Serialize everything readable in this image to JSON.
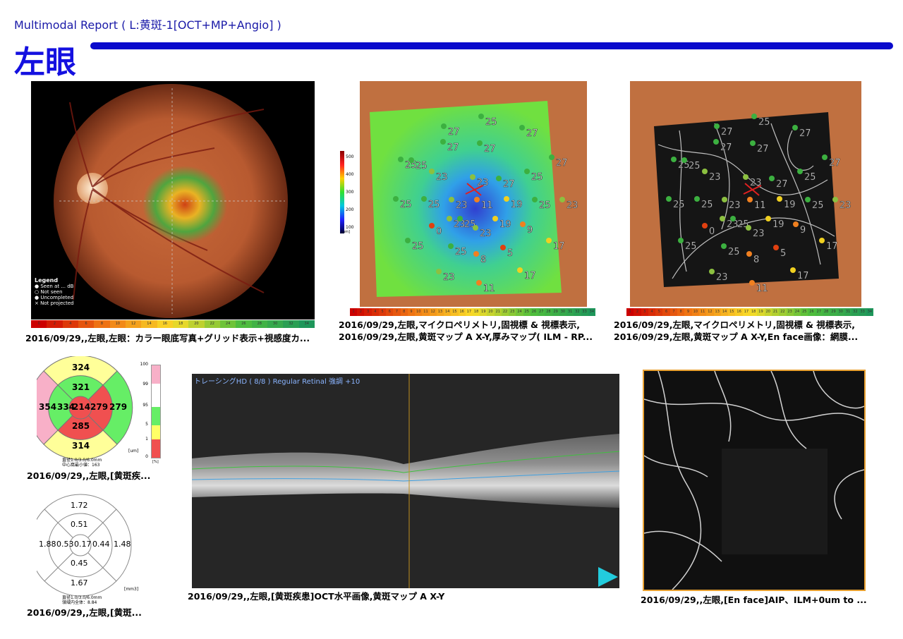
{
  "header": {
    "title": "Multimodal Report ( L:黄斑-1[OCT+MP+Angio] )",
    "eye": "左眼"
  },
  "fundus": {
    "legend_title": "Legend",
    "legend_items": [
      "Seen at ... dB",
      "Not seen",
      "Uncompleted",
      "Not projected"
    ],
    "scale_labels": [
      "0",
      "2",
      "4",
      "6",
      "8",
      "10",
      "12",
      "14",
      "16",
      "18",
      "20",
      "22",
      "24",
      "26",
      "28",
      "30",
      "32",
      "34"
    ],
    "caption": "2016/09/29,,左眼,左眼：カラー眼底写真+グリッド表示+視感度カ..."
  },
  "thickness_map": {
    "colorbar_ticks": [
      "500",
      "400",
      "300",
      "200",
      "100"
    ],
    "colorbar_unit": "[um]",
    "caption_line1": "2016/09/29,左眼,マイクロペリメトリ,固視標 & 視標表示,",
    "caption_line2": "2016/09/29,左眼,黄斑マップ A X-Y,厚みマップ( ILM - RP..."
  },
  "enface_overlay": {
    "caption_line1": "2016/09/29,左眼,マイクロペリメトリ,固視標 & 視標表示,",
    "caption_line2": "2016/09/29,左眼,黄斑マップ A X-Y,En face画像：網膜..."
  },
  "perimetry_scale": [
    "1",
    "2",
    "3",
    "4",
    "5",
    "6",
    "7",
    "8",
    "9",
    "10",
    "11",
    "12",
    "13",
    "14",
    "15",
    "16",
    "17",
    "18",
    "19",
    "20",
    "21",
    "22",
    "23",
    "24",
    "25",
    "26",
    "27",
    "28",
    "29",
    "30",
    "31",
    "32",
    "33",
    "34"
  ],
  "perimetry_points": [
    "25",
    "27",
    "27",
    "27",
    "27",
    "25",
    "25",
    "27",
    "25",
    "23",
    "23",
    "27",
    "25",
    "25",
    "23",
    "25",
    "23",
    "11",
    "19",
    "23",
    "25",
    "19",
    "0",
    "25",
    "25",
    "23",
    "8",
    "5",
    "17",
    "9",
    "17",
    "23",
    "11"
  ],
  "etdrs_thickness": {
    "outer_top": "324",
    "inner_top": "321",
    "outer_left": "354",
    "inner_left": "334",
    "center": "214",
    "inner_right": "279",
    "outer_right": "279",
    "inner_bottom": "285",
    "outer_bottom": "314",
    "unit": "[um]",
    "legend_ticks": [
      "100",
      "99",
      "95",
      "5",
      "1",
      "0"
    ],
    "legend_unit": "[%]",
    "note1": "直径1.0/3.0/6.0mm",
    "note2": "中心窩最小値：163",
    "caption": "2016/09/29,,左眼,[黄斑疾..."
  },
  "etdrs_volume": {
    "outer_top": "1.72",
    "inner_top": "0.51",
    "outer_left": "1.88",
    "inner_left": "0.53",
    "center": "0.17",
    "inner_right": "0.44",
    "outer_right": "1.48",
    "inner_bottom": "0.45",
    "outer_bottom": "1.67",
    "unit": "[mm3]",
    "note1": "直径1.0/3.0/6.0mm",
    "note2": "領域内全体：8.84",
    "caption": "2016/09/29,,左眼,[黄斑..."
  },
  "oct": {
    "overlay_label": "トレーシングHD ( 8/8 ) Regular Retinal  強調 +10",
    "caption": "2016/09/29,,左眼,[黄斑疾患]OCT水平画像,黄斑マップ A X-Y"
  },
  "angio": {
    "caption": "2016/09/29,,左眼,[En face]AIP、ILM+0um to ..."
  },
  "colors": {
    "accent_blue": "#0a0acc",
    "angio_border": "#e8a030",
    "play_icon": "#22ccdd"
  }
}
